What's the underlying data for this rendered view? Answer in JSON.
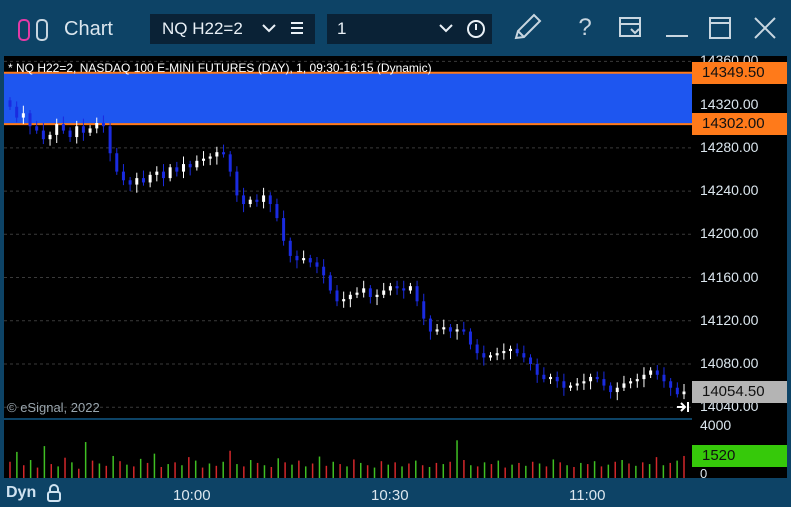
{
  "titlebar": {
    "app_title": "Chart",
    "symbol": "NQ H22=2",
    "interval": "1",
    "icons": [
      "app-logo-icon",
      "chevron-down-icon",
      "menu-icon",
      "chevron-down-icon",
      "clock-icon",
      "pencil-icon",
      "help-icon",
      "save-template-icon",
      "minimize-icon",
      "maximize-icon",
      "close-icon"
    ],
    "help_glyph": "?"
  },
  "chart": {
    "info_line": "* NQ H22=2, NASDAQ 100 E-MINI FUTURES (DAY), 1, 09:30-16:15 (Dynamic)",
    "copyright": "© eSignal, 2022",
    "dyn_label": "Dyn",
    "colors": {
      "background": "#000000",
      "up_candle": "#ffffff",
      "down_candle": "#1a2be0",
      "zone": "#1e56f0",
      "zone_border": "#ff7a1a",
      "last_price_badge": "#b4b4b4",
      "volume_badge": "#36c90a"
    }
  },
  "chart_data": {
    "type": "candlestick",
    "symbol": "NQ H22=2",
    "y_axis": {
      "labels": [
        "14360.00",
        "14320.00",
        "14280.00",
        "14240.00",
        "14200.00",
        "14160.00",
        "14120.00",
        "14080.00",
        "14040.00"
      ],
      "range": [
        14030,
        14365
      ]
    },
    "zone": {
      "upper": 14349.5,
      "lower": 14302.0,
      "upper_label": "14349.50",
      "lower_label": "14302.00"
    },
    "last_price": {
      "value": 14054.5,
      "label": "14054.50"
    },
    "x_axis": {
      "labels": [
        "10:00",
        "10:30",
        "11:00"
      ]
    },
    "volume_axis": {
      "labels": [
        "4000",
        "0"
      ],
      "range": [
        0,
        4000
      ],
      "last_label": "1520",
      "last_value": 1520
    },
    "candle_closes": [
      14318,
      14308,
      14312,
      14300,
      14296,
      14288,
      14292,
      14302,
      14296,
      14290,
      14300,
      14294,
      14298,
      14303,
      14300,
      14275,
      14258,
      14250,
      14246,
      14252,
      14248,
      14255,
      14258,
      14252,
      14262,
      14258,
      14265,
      14262,
      14268,
      14270,
      14272,
      14276,
      14274,
      14258,
      14236,
      14228,
      14232,
      14230,
      14236,
      14228,
      14215,
      14194,
      14180,
      14176,
      14178,
      14174,
      14170,
      14162,
      14148,
      14138,
      14140,
      14144,
      14146,
      14150,
      14142,
      14144,
      14148,
      14152,
      14150,
      14148,
      14152,
      14138,
      14122,
      14110,
      14112,
      14114,
      14110,
      14112,
      14110,
      14098,
      14090,
      14086,
      14088,
      14090,
      14092,
      14094,
      14090,
      14086,
      14080,
      14070,
      14066,
      14068,
      14064,
      14058,
      14060,
      14062,
      14064,
      14068,
      14066,
      14060,
      14054,
      14058,
      14062,
      14064,
      14066,
      14070,
      14074,
      14070,
      14064,
      14058,
      14052,
      14054.5
    ],
    "volume_bars": [
      0.28,
      0.45,
      0.22,
      0.31,
      0.18,
      0.55,
      0.24,
      0.2,
      0.35,
      0.27,
      0.16,
      0.62,
      0.3,
      0.25,
      0.21,
      0.38,
      0.29,
      0.23,
      0.2,
      0.33,
      0.26,
      0.42,
      0.19,
      0.24,
      0.27,
      0.22,
      0.36,
      0.3,
      0.18,
      0.25,
      0.21,
      0.28,
      0.47,
      0.24,
      0.2,
      0.31,
      0.26,
      0.22,
      0.19,
      0.34,
      0.27,
      0.23,
      0.3,
      0.2,
      0.25,
      0.37,
      0.21,
      0.28,
      0.24,
      0.2,
      0.32,
      0.26,
      0.22,
      0.18,
      0.29,
      0.23,
      0.27,
      0.2,
      0.25,
      0.3,
      0.22,
      0.19,
      0.26,
      0.24,
      0.28,
      0.65,
      0.31,
      0.22,
      0.2,
      0.27,
      0.24,
      0.3,
      0.18,
      0.23,
      0.26,
      0.21,
      0.28,
      0.25,
      0.2,
      0.32,
      0.27,
      0.22,
      0.19,
      0.26,
      0.24,
      0.29,
      0.2,
      0.23,
      0.28,
      0.31,
      0.25,
      0.21,
      0.27,
      0.24,
      0.36,
      0.22,
      0.26,
      0.3,
      0.38
    ]
  }
}
